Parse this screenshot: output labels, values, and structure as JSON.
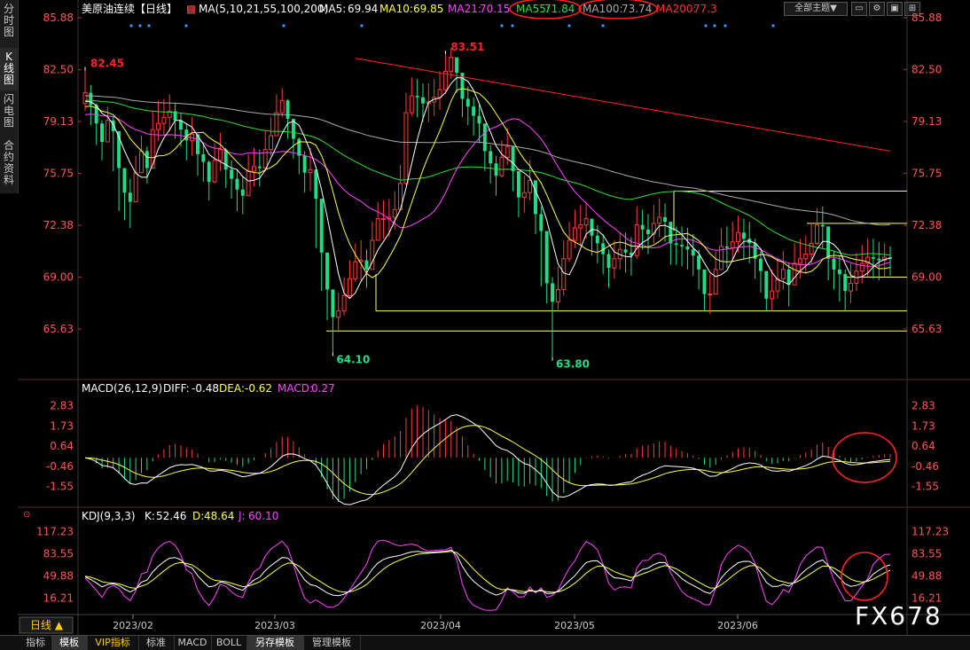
{
  "side_tabs": [
    {
      "label": "分时图"
    },
    {
      "label": "K线图"
    },
    {
      "label": "闪电图"
    },
    {
      "label": "合约资料"
    }
  ],
  "toolbar": {
    "theme_select": "全部主题▼",
    "icon_names": [
      "window-icon",
      "settings-icon",
      "layout-icon",
      "grid-icon"
    ]
  },
  "bottom_tabs": [
    {
      "label": "指标"
    },
    {
      "label": "模板"
    },
    {
      "label": "VIP指标"
    },
    {
      "label": "标准"
    },
    {
      "label": "MACD"
    },
    {
      "label": "BOLL"
    },
    {
      "label": "另存模板"
    },
    {
      "label": "管理模板"
    }
  ],
  "period_label": "日线 ▲",
  "watermark": "FX678",
  "colors": {
    "up": "#ff3c3c",
    "down": "#22dd88",
    "ma5": "#ffffff",
    "ma10": "#ffff44",
    "ma21": "#ff44ff",
    "ma55": "#33dd33",
    "ma100": "#aaaaaa",
    "ma200": "#ff2222",
    "macd_diff": "#ffffff",
    "macd_dea": "#ffff44",
    "kdj_k": "#ffffff",
    "kdj_d": "#ffff44",
    "kdj_j": "#ff44ff",
    "annotation": "#ff2222",
    "level": "#ffff66"
  },
  "chart_data": [
    {
      "type": "candlestick",
      "title": "美原油连续【日线】",
      "legend": [
        {
          "name": "MA(5,10,21,55,100,200)",
          "value": ""
        },
        {
          "name": "MA5:",
          "value": "69.94"
        },
        {
          "name": "MA10:",
          "value": "69.85"
        },
        {
          "name": "MA21:",
          "value": "70.15"
        },
        {
          "name": "MA55:",
          "value": "71.84"
        },
        {
          "name": "MA100:",
          "value": "73.74"
        },
        {
          "name": "MA200:",
          "value": "77.3"
        }
      ],
      "yticks": [
        "85.88",
        "82.50",
        "79.13",
        "75.75",
        "72.38",
        "69.00",
        "65.63"
      ],
      "ylim": [
        62.8,
        85.88
      ],
      "xticks": [
        "2023/02",
        "2023/03",
        "2023/04",
        "2023/05",
        "2023/06"
      ],
      "annotations": [
        {
          "label": "82.45",
          "value": 82.45
        },
        {
          "label": "83.51",
          "value": 83.51
        },
        {
          "label": "64.10",
          "value": 64.1
        },
        {
          "label": "63.80",
          "value": 63.8
        }
      ],
      "horizontal_levels": [
        74.6,
        72.5,
        69.0,
        66.8,
        65.5
      ],
      "closes": [
        81.0,
        80.2,
        79.0,
        77.8,
        79.2,
        78.5,
        76.1,
        74.5,
        73.9,
        75.8,
        77.2,
        76.1,
        78.6,
        79.0,
        79.4,
        79.8,
        79.2,
        78.6,
        77.9,
        78.3,
        77.0,
        76.5,
        75.2,
        76.6,
        77.3,
        76.0,
        75.4,
        74.7,
        74.3,
        75.9,
        76.2,
        76.1,
        77.3,
        78.2,
        79.7,
        80.5,
        79.3,
        78.0,
        76.9,
        75.8,
        76.0,
        74.1,
        70.6,
        68.2,
        66.4,
        66.8,
        67.8,
        68.9,
        70.0,
        70.1,
        69.5,
        71.4,
        72.8,
        72.8,
        72.9,
        73.4,
        75.1,
        79.7,
        80.8,
        80.7,
        80.3,
        80.4,
        80.7,
        81.2,
        82.4,
        83.3,
        82.3,
        80.6,
        80.1,
        79.5,
        79.0,
        77.2,
        76.4,
        75.6,
        76.8,
        77.5,
        75.9,
        74.2,
        74.5,
        75.3,
        73.1,
        72.0,
        68.6,
        67.4,
        68.2,
        70.2,
        71.4,
        72.2,
        72.4,
        72.8,
        71.7,
        71.2,
        70.5,
        69.6,
        70.2,
        70.8,
        70.6,
        70.4,
        72.4,
        72.1,
        71.8,
        72.5,
        72.9,
        72.6,
        71.2,
        71.1,
        71.0,
        70.8,
        70.4,
        69.5,
        67.9,
        67.9,
        69.5,
        71.0,
        70.9,
        71.3,
        71.9,
        71.5,
        71.2,
        70.2,
        69.4,
        67.6,
        68.1,
        68.9,
        69.5,
        68.5,
        69.9,
        70.2,
        70.5,
        71.2,
        72.4,
        72.3,
        70.2,
        69.5,
        69.2,
        68.1,
        68.6,
        69.4,
        69.9,
        70.3,
        70.2,
        70.1,
        70.3,
        70.2
      ],
      "highs": [
        82.45,
        81.5,
        80.3,
        79.2,
        80.1,
        79.5,
        77.8,
        75.8,
        75.4,
        76.9,
        78.2,
        77.5,
        79.8,
        80.5,
        80.6,
        80.9,
        80.3,
        79.7,
        79.0,
        79.4,
        78.3,
        77.7,
        76.6,
        77.7,
        78.4,
        77.4,
        76.6,
        76.0,
        75.6,
        77.0,
        77.4,
        77.3,
        78.5,
        79.4,
        80.9,
        81.3,
        80.6,
        79.2,
        78.1,
        77.2,
        77.4,
        75.4,
        72.7,
        69.6,
        67.6,
        68.0,
        69.0,
        70.1,
        71.2,
        71.4,
        70.8,
        72.6,
        73.9,
        74.0,
        74.1,
        74.6,
        76.3,
        81.0,
        82.0,
        81.9,
        81.6,
        81.6,
        81.9,
        82.4,
        83.51,
        83.9,
        83.0,
        81.6,
        81.4,
        80.7,
        80.2,
        78.9,
        77.6,
        76.9,
        77.9,
        78.7,
        77.4,
        75.4,
        75.6,
        76.6,
        74.3,
        73.6,
        70.6,
        69.0,
        69.7,
        71.4,
        72.6,
        73.4,
        73.7,
        73.9,
        72.8,
        72.4,
        71.8,
        70.8,
        71.4,
        71.9,
        71.9,
        71.6,
        73.6,
        73.4,
        73.1,
        73.7,
        74.1,
        73.8,
        72.6,
        72.3,
        72.3,
        72.2,
        71.8,
        70.8,
        69.2,
        69.2,
        70.7,
        72.2,
        72.3,
        72.6,
        73.0,
        72.8,
        72.6,
        71.5,
        70.7,
        68.8,
        69.5,
        70.2,
        70.7,
        69.9,
        71.2,
        71.5,
        71.7,
        72.5,
        73.5,
        73.6,
        71.5,
        70.7,
        70.4,
        69.5,
        69.9,
        70.6,
        71.1,
        71.5,
        71.5,
        71.3,
        71.2,
        71.0
      ],
      "lows": [
        79.8,
        78.9,
        77.6,
        76.6,
        77.9,
        75.9,
        73.3,
        72.7,
        72.2,
        73.9,
        75.9,
        75.1,
        76.9,
        77.9,
        78.2,
        78.5,
        78.0,
        77.5,
        76.6,
        76.9,
        75.6,
        75.2,
        74.0,
        75.1,
        75.9,
        74.8,
        74.1,
        73.3,
        73.1,
        74.5,
        74.9,
        74.9,
        75.9,
        76.9,
        78.5,
        79.4,
        78.0,
        76.7,
        75.7,
        74.5,
        74.6,
        70.9,
        68.1,
        66.2,
        64.1,
        65.5,
        66.5,
        67.6,
        68.7,
        68.8,
        68.3,
        70.0,
        71.6,
        71.5,
        71.6,
        72.1,
        73.8,
        75.0,
        79.5,
        79.4,
        79.1,
        79.1,
        79.5,
        79.9,
        80.9,
        81.9,
        81.0,
        79.4,
        78.9,
        78.2,
        77.7,
        75.9,
        75.1,
        74.3,
        75.5,
        76.3,
        74.6,
        72.9,
        73.2,
        74.0,
        71.8,
        68.4,
        67.3,
        63.8,
        66.9,
        67.8,
        70.0,
        70.9,
        71.1,
        71.5,
        70.4,
        69.9,
        69.2,
        68.3,
        68.9,
        69.5,
        69.3,
        69.1,
        70.2,
        70.8,
        70.5,
        71.2,
        71.6,
        71.3,
        69.8,
        69.8,
        69.7,
        69.5,
        69.1,
        68.2,
        66.8,
        66.6,
        68.1,
        69.6,
        69.6,
        70.0,
        70.6,
        70.2,
        69.9,
        68.9,
        68.0,
        66.8,
        66.8,
        67.6,
        68.2,
        67.1,
        68.6,
        68.9,
        69.2,
        69.9,
        71.1,
        70.9,
        68.8,
        68.2,
        67.4,
        66.8,
        67.3,
        68.1,
        68.6,
        69.0,
        68.9,
        68.8,
        69.0,
        69.1
      ]
    },
    {
      "type": "macd",
      "title": "MACD(26,12,9)",
      "legend": [
        {
          "name": "DIFF:",
          "value": "-0.48"
        },
        {
          "name": "DEA:",
          "value": "-0.62"
        },
        {
          "name": "MACD:",
          "value": "0.27"
        }
      ],
      "yticks": [
        "2.83",
        "1.73",
        "0.64",
        "-0.46",
        "-1.55"
      ],
      "ylim": [
        -2.5,
        3.3
      ]
    },
    {
      "type": "kdj",
      "title": "KDJ(9,3,3)",
      "legend": [
        {
          "name": "K:",
          "value": "52.46"
        },
        {
          "name": "D:",
          "value": "48.64"
        },
        {
          "name": "J:",
          "value": "60.10"
        }
      ],
      "yticks": [
        "117.23",
        "83.55",
        "49.88",
        "16.21"
      ],
      "ylim": [
        -5,
        125
      ]
    }
  ]
}
